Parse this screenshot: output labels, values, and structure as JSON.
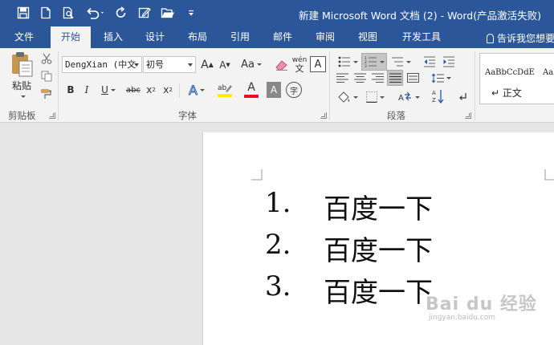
{
  "window": {
    "title": "新建 Microsoft Word 文档 (2) - Word(产品激活失败)"
  },
  "quick_access": {
    "icons": [
      "save-icon",
      "new-document-icon",
      "print-preview-icon",
      "undo-icon",
      "redo-icon",
      "edit-icon",
      "open-folder-icon",
      "customize-icon"
    ]
  },
  "tabs": [
    "文件",
    "开始",
    "插入",
    "设计",
    "布局",
    "引用",
    "邮件",
    "审阅",
    "视图",
    "开发工具"
  ],
  "active_tab": "开始",
  "tell_me": "告诉我您想要",
  "ribbon": {
    "clipboard": {
      "label": "剪贴板",
      "paste": "粘贴"
    },
    "font": {
      "label": "字体",
      "font_name": "DengXian (中文",
      "font_size": "初号",
      "grow": "A",
      "shrink": "A",
      "change_case": "Aa",
      "phonetic": "wén",
      "bold": "B",
      "italic": "I",
      "underline": "U",
      "strikethrough": "abc",
      "subscript": "x",
      "superscript": "x",
      "text_effects": "A",
      "font_color": "A",
      "char_shading": "A",
      "enclose": "字"
    },
    "paragraph": {
      "label": "段落"
    },
    "styles": {
      "items": [
        {
          "sample": "AaBbCcDdE",
          "name": "↵ 正文"
        },
        {
          "sample": "AaB",
          "name": ""
        }
      ]
    }
  },
  "colors": {
    "accent": "#2b579a",
    "highlight": "#ffee00",
    "font_color": "#e81123"
  },
  "document": {
    "list": [
      {
        "number": "1.",
        "text": "百度一下"
      },
      {
        "number": "2.",
        "text": "百度一下"
      },
      {
        "number": "3.",
        "text": "百度一下"
      }
    ]
  },
  "watermark": {
    "logo_text": "Bai du 经验",
    "url": "jingyan.baidu.com"
  }
}
